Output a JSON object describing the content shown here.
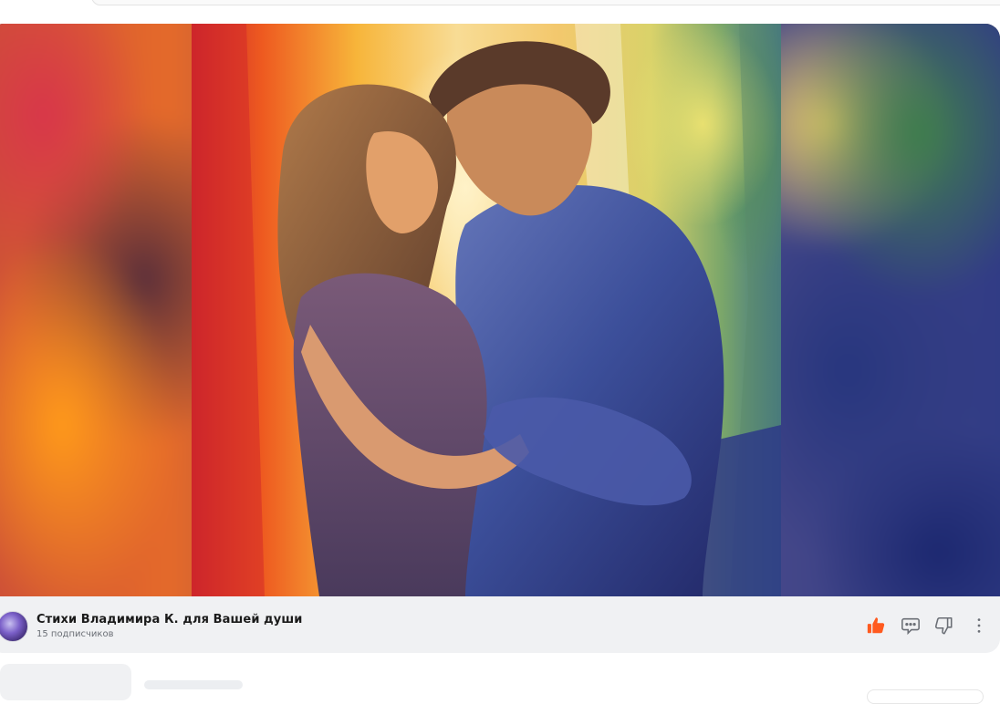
{
  "post": {
    "image_alt": "Watercolor painting of an embracing couple",
    "channel": {
      "name": "Стихи Владимира К. для Вашей души",
      "subscribers": "15 подписчиков"
    },
    "actions": [
      {
        "name": "like",
        "icon": "thumbs-up-icon",
        "active": true,
        "color": "#ff5a1f"
      },
      {
        "name": "comment",
        "icon": "comment-icon",
        "active": false
      },
      {
        "name": "dislike",
        "icon": "thumbs-down-icon",
        "active": false
      },
      {
        "name": "more",
        "icon": "more-vertical-icon",
        "active": false
      }
    ]
  },
  "colors": {
    "accent": "#ff5a1f",
    "card_bg": "#f0f1f3",
    "text_primary": "#1a1a1a",
    "text_secondary": "#6b6f76",
    "icon_gray": "#6b6f76"
  }
}
